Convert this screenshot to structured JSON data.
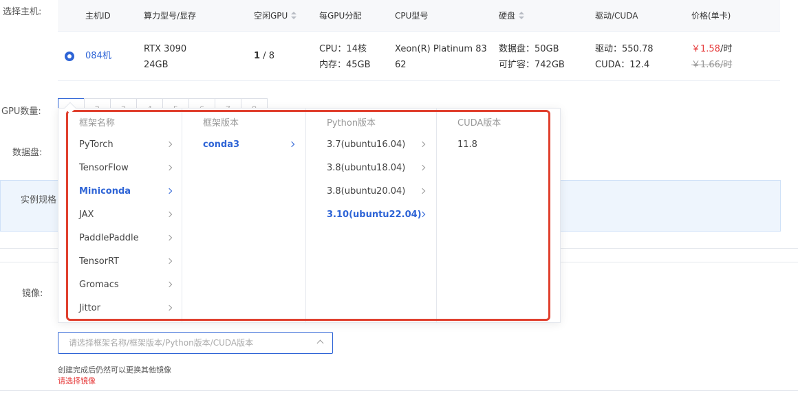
{
  "labels": {
    "select_host": "选择主机:",
    "gpu_count": "GPU数量:",
    "data_disk": "数据盘:",
    "instance_spec": "实例规格",
    "image": "镜像:"
  },
  "host_table": {
    "headers": [
      "主机ID",
      "算力型号/显存",
      "空闲GPU",
      "每GPU分配",
      "CPU型号",
      "硬盘",
      "驱动/CUDA",
      "价格(单卡)"
    ],
    "row": {
      "id": "084机",
      "gpu_model": "RTX 3090",
      "vram": "24GB",
      "free_gpu": "1",
      "total_gpu": " / 8",
      "cpu_alloc": "CPU：14核",
      "mem_alloc": "内存：45GB",
      "cpu_model_1": "Xeon(R) Platinum 83",
      "cpu_model_2": "62",
      "disk": "数据盘：50GB",
      "disk_expand": "可扩容：742GB",
      "driver": "驱动：550.78",
      "cuda": "CUDA：12.4",
      "price": "￥1.58",
      "price_unit": "/时",
      "orig_price": "￥1.66/时"
    }
  },
  "gpu_pager": [
    "1",
    "2",
    "3",
    "4",
    "5",
    "6",
    "7",
    "8"
  ],
  "cascader": {
    "col1_title": "框架名称",
    "col2_title": "框架版本",
    "col3_title": "Python版本",
    "col4_title": "CUDA版本",
    "frameworks": [
      "PyTorch",
      "TensorFlow",
      "Miniconda",
      "JAX",
      "PaddlePaddle",
      "TensorRT",
      "Gromacs",
      "Jittor"
    ],
    "versions": [
      "conda3"
    ],
    "python": [
      "3.7(ubuntu16.04)",
      "3.8(ubuntu18.04)",
      "3.8(ubuntu20.04)",
      "3.10(ubuntu22.04)"
    ],
    "cuda": [
      "11.8"
    ]
  },
  "select": {
    "placeholder": "请选择框架名称/框架版本/Python版本/CUDA版本"
  },
  "hint": "创建完成后仍然可以更换其他镜像",
  "error": "请选择镜像",
  "colors": {
    "primary": "#2e64d6",
    "danger": "#e63b3b",
    "highlight_box": "#e0402e"
  }
}
